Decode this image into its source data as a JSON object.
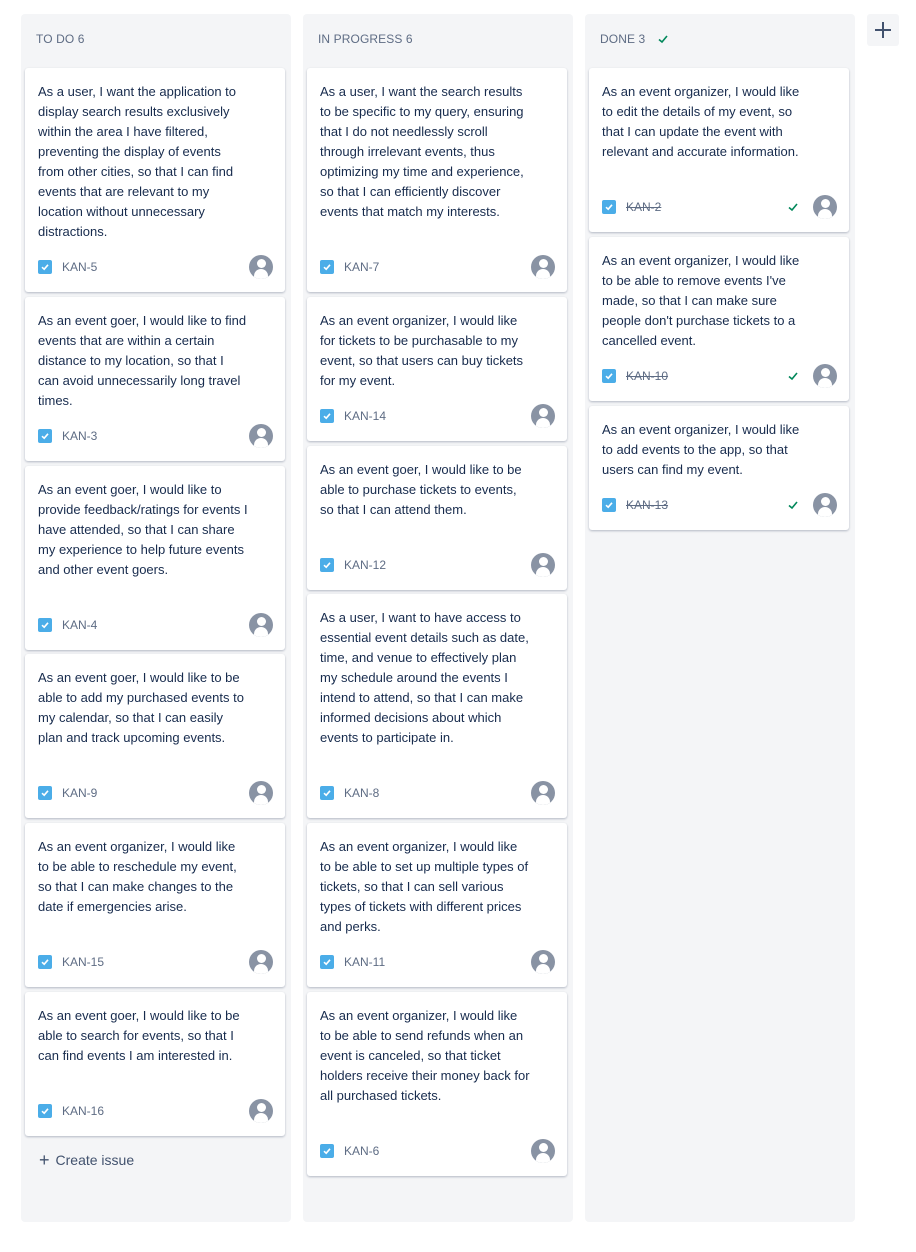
{
  "columns": [
    {
      "title": "TO DO 6",
      "done": false,
      "create_label": "Create issue",
      "cards": [
        {
          "text": "As a user, I want the application to display search results exclusively within the area I have filtered, preventing the display of events from other cities, so that I can find events that are relevant to my location without unnecessary distractions.",
          "key": "KAN-5"
        },
        {
          "text": "As an event goer, I would like to find events that are within a certain distance to my location, so that I can avoid unnecessarily long travel times.",
          "key": "KAN-3"
        },
        {
          "text": "As an event goer, I would like to provide feedback/ratings for events I have attended, so that I can share my experience to help future events and other event goers.",
          "key": "KAN-4"
        },
        {
          "text": "As an event goer, I would like to be able to add my purchased events to my calendar, so that I can easily plan and track upcoming events.",
          "key": "KAN-9"
        },
        {
          "text": "As an event organizer, I would like to be able to reschedule my event, so that I can make changes to the date if emergencies arise.",
          "key": "KAN-15"
        },
        {
          "text": "As an event goer, I would like to be able to search for events, so that I can find events I am interested in.",
          "key": "KAN-16"
        }
      ]
    },
    {
      "title": "IN PROGRESS 6",
      "done": false,
      "cards": [
        {
          "text": "As a user, I want the search results to be specific to my query, ensuring that I do not needlessly scroll through irrelevant events, thus optimizing my time and experience, so that I can efficiently discover events that match my interests.",
          "key": "KAN-7"
        },
        {
          "text": "As an event organizer, I would like for tickets to be purchasable to my event, so that users can buy tickets for my event.",
          "key": "KAN-14"
        },
        {
          "text": "As an event goer, I would like to be able to purchase tickets to events, so that I can attend them.",
          "key": "KAN-12"
        },
        {
          "text": "As a user, I want to have access to essential event details such as date, time, and venue to effectively plan my schedule around the events I intend to attend, so that I can make informed decisions about which events to participate in.",
          "key": "KAN-8"
        },
        {
          "text": "As an event organizer, I would like to be able to set up multiple types of tickets, so that I can sell various types of tickets with different prices and perks.",
          "key": "KAN-11"
        },
        {
          "text": "As an event organizer, I would like to be able to send refunds when an event is canceled, so that ticket holders receive their money back for all purchased tickets.",
          "key": "KAN-6"
        }
      ]
    },
    {
      "title": "DONE 3",
      "done": true,
      "cards": [
        {
          "text": "As an event organizer, I would like to edit the details of my event, so that I can update the event with relevant and accurate information.",
          "key": "KAN-2"
        },
        {
          "text": "As an event organizer, I would like to be able to remove events I've made, so that I can make sure people don't purchase tickets to a cancelled event.",
          "key": "KAN-10"
        },
        {
          "text": "As an event organizer, I would like to add events to the app, so that users can find my event.",
          "key": "KAN-13"
        }
      ]
    }
  ],
  "colors": {
    "story_icon": "#4bade8",
    "done_check": "#00875a",
    "avatar": "#8993a4",
    "column_bg": "#f4f5f7"
  },
  "icons": {
    "story": "checkbox-story-icon",
    "done": "check-icon",
    "avatar": "person-avatar-icon",
    "add_column": "plus-icon"
  }
}
